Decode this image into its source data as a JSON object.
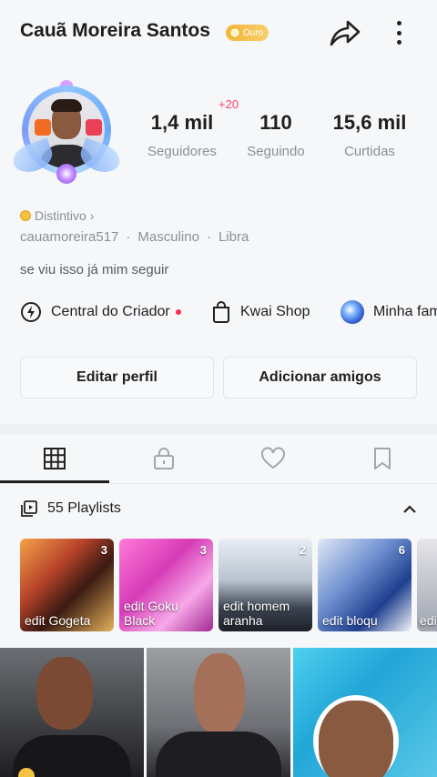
{
  "header": {
    "name": "Cauã Moreira Santos",
    "badge": "Ouro",
    "icons": [
      "share-icon",
      "more-vertical-icon"
    ]
  },
  "profile": {
    "followers_delta": "+20",
    "stats": [
      {
        "value": "1,4 mil",
        "label": "Seguidores"
      },
      {
        "value": "110",
        "label": "Seguindo"
      },
      {
        "value": "15,6 mil",
        "label": "Curtidas"
      }
    ],
    "distinctive": "Distintivo",
    "username": "cauamoreira517",
    "gender": "Masculino",
    "sign": "Libra",
    "bio": "se viu isso já mim seguir"
  },
  "shortcuts": [
    {
      "label": "Central do Criador",
      "icon": "lightning-icon"
    },
    {
      "label": "Kwai Shop",
      "icon": "shopping-bag-icon"
    },
    {
      "label": "Minha fam",
      "icon": "family-avatar"
    }
  ],
  "actions": {
    "edit": "Editar perfil",
    "add_friends": "Adicionar amigos"
  },
  "tabs": [
    "grid-icon",
    "lock-icon",
    "heart-icon",
    "bookmark-icon"
  ],
  "playlists": {
    "title": "55 Playlists",
    "items": [
      {
        "name": "edit Gogeta",
        "count": "3"
      },
      {
        "name": "edit Goku Black",
        "count": "3"
      },
      {
        "name": "edit homem aranha",
        "count": "2"
      },
      {
        "name": "edit bloqu",
        "count": "6"
      },
      {
        "name": "edit",
        "count": ""
      }
    ]
  },
  "colors": {
    "accent": "#ff2b4a",
    "badge_gold": "#f4b63c",
    "text": "#1e1e1e",
    "muted": "#8a8f98"
  }
}
